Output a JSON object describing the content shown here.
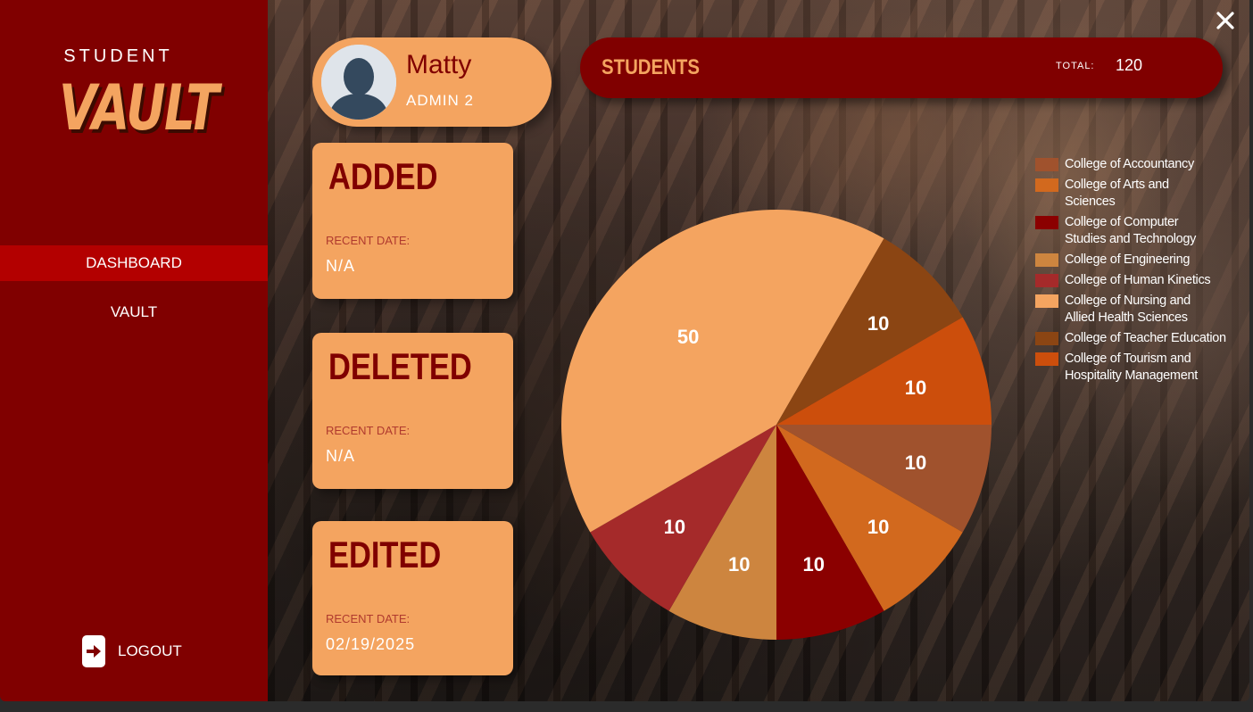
{
  "app": {
    "logo_top": "STUDENT",
    "logo_main": "VAULT"
  },
  "sidebar": {
    "items": [
      {
        "label": "DASHBOARD",
        "active": true
      },
      {
        "label": "VAULT",
        "active": false
      }
    ],
    "logout_label": "LOGOUT"
  },
  "profile": {
    "name": "Matty",
    "role": "ADMIN 2"
  },
  "students": {
    "title": "STUDENTS",
    "total_label": "TOTAL:",
    "total_value": "120"
  },
  "cards": [
    {
      "title": "ADDED",
      "date_label": "RECENT DATE:",
      "date_value": "N/A"
    },
    {
      "title": "DELETED",
      "date_label": "RECENT DATE:",
      "date_value": "N/A"
    },
    {
      "title": "EDITED",
      "date_label": "RECENT DATE:",
      "date_value": "02/19/2025"
    }
  ],
  "colors": {
    "sidebar": "#800000",
    "accent": "#f4a460",
    "active_nav": "#b30000"
  },
  "chart_data": {
    "type": "pie",
    "categories": [
      "College of Accountancy",
      "College of Arts and Sciences",
      "College of Computer Studies and Technology",
      "College of Engineering",
      "College of Human Kinetics",
      "College of Nursing and Allied Health Sciences",
      "College of Teacher Education",
      "College of Tourism and Hospitality Management"
    ],
    "values": [
      10,
      10,
      10,
      10,
      10,
      50,
      10,
      10
    ],
    "colors": [
      "#a0522d",
      "#d2691e",
      "#8b0000",
      "#cd853f",
      "#a52a2a",
      "#f4a460",
      "#8b4513",
      "#cc4e0c"
    ],
    "legend_lines": [
      [
        "College of Accountancy"
      ],
      [
        "College of Arts and",
        "Sciences"
      ],
      [
        "College of Computer",
        "Studies and Technology"
      ],
      [
        "College of Engineering"
      ],
      [
        "College of Human Kinetics"
      ],
      [
        "College of Nursing and",
        "Allied Health Sciences"
      ],
      [
        "College of Teacher Education"
      ],
      [
        "College of Tourism and",
        "Hospitality Management"
      ]
    ],
    "legend_position": "right"
  }
}
